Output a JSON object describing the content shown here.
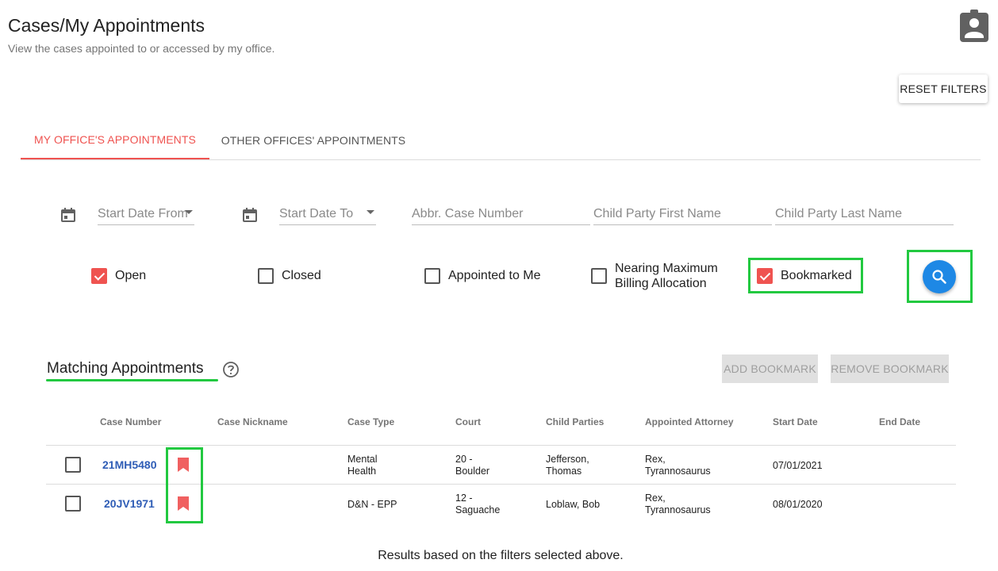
{
  "header": {
    "title": "Cases/My Appointments",
    "subtitle": "View the cases appointed to or accessed by my office.",
    "profile_icon": "account-box-icon"
  },
  "toolbar": {
    "reset_label": "RESET FILTERS"
  },
  "tabs": [
    {
      "label": "MY OFFICE'S APPOINTMENTS",
      "active": true
    },
    {
      "label": "OTHER OFFICES' APPOINTMENTS",
      "active": false
    }
  ],
  "filters": {
    "start_date_from": {
      "placeholder": "Start Date From",
      "icon": "calendar-icon"
    },
    "start_date_to": {
      "placeholder": "Start Date To",
      "icon": "calendar-icon"
    },
    "abbr_case_number": {
      "placeholder": "Abbr. Case Number"
    },
    "child_first_name": {
      "placeholder": "Child Party First Name"
    },
    "child_last_name": {
      "placeholder": "Child Party Last Name"
    }
  },
  "checkboxes": [
    {
      "label": "Open",
      "checked": true
    },
    {
      "label": "Closed",
      "checked": false
    },
    {
      "label": "Appointed to Me",
      "checked": false
    },
    {
      "label": "Nearing Maximum Billing Allocation",
      "checked": false
    },
    {
      "label": "Bookmarked",
      "checked": true
    }
  ],
  "search": {
    "icon": "search-icon"
  },
  "results": {
    "title": "Matching Appointments",
    "help_icon": "help-circle-icon",
    "add_bookmark_label": "ADD BOOKMARK",
    "remove_bookmark_label": "REMOVE BOOKMARK",
    "columns": [
      "Case Number",
      "Case Nickname",
      "Case Type",
      "Court",
      "Child Parties",
      "Appointed Attorney",
      "Start Date",
      "End Date"
    ],
    "rows": [
      {
        "case_number": "21MH5480",
        "bookmarked": true,
        "nickname": "",
        "case_type": "Mental Health",
        "court": "20 - Boulder",
        "child_parties": "Jefferson, Thomas",
        "attorney": "Rex, Tyrannosaurus",
        "start_date": "07/01/2021",
        "end_date": ""
      },
      {
        "case_number": "20JV1971",
        "bookmarked": true,
        "nickname": "",
        "case_type": "D&N - EPP",
        "court": "12 - Saguache",
        "child_parties": "Loblaw, Bob",
        "attorney": "Rex, Tyrannosaurus",
        "start_date": "08/01/2020",
        "end_date": ""
      }
    ],
    "footer": "Results based on the filters selected above."
  },
  "colors": {
    "accent": "#ef5350",
    "highlight": "#22c940",
    "link": "#2f5db6",
    "search_button": "#1e88e5"
  }
}
